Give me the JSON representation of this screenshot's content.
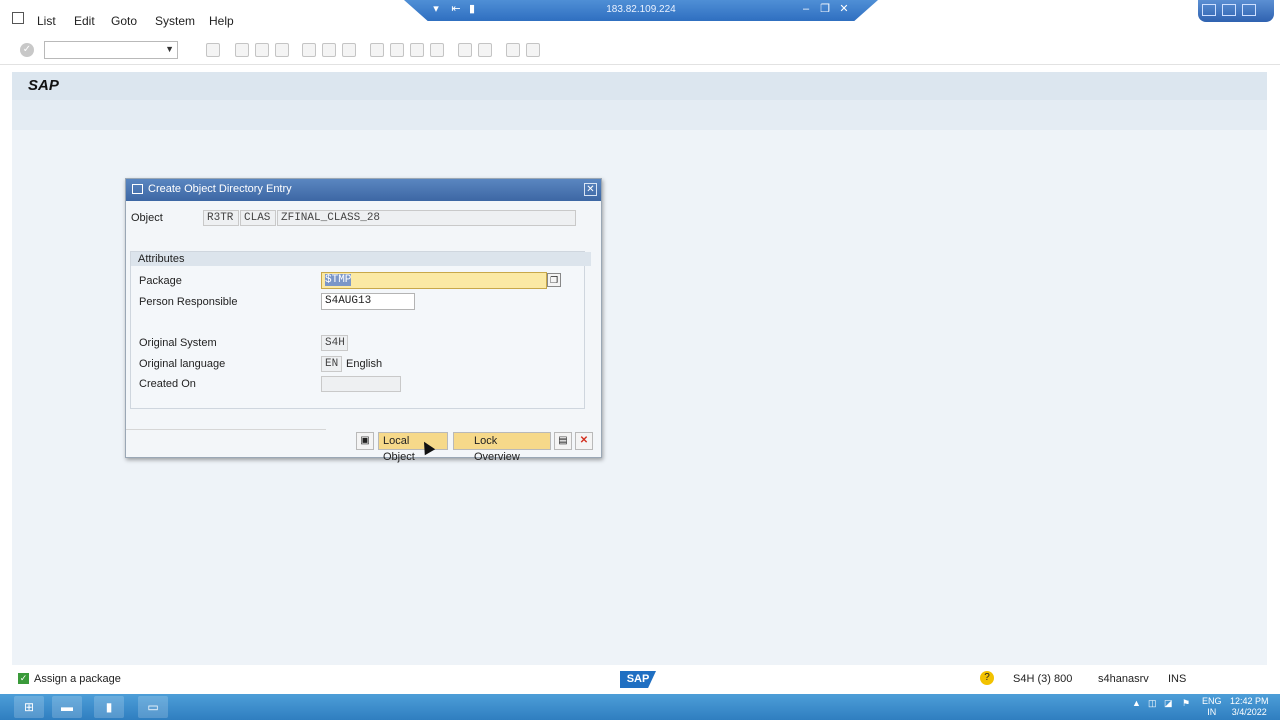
{
  "remote": {
    "ip": "183.82.109.224"
  },
  "menu": {
    "items": [
      "List",
      "Edit",
      "Goto",
      "System",
      "Help"
    ]
  },
  "header": {
    "title": "SAP"
  },
  "dialog": {
    "title": "Create Object Directory Entry",
    "object_label": "Object",
    "object_pgmid": "R3TR",
    "object_type": "CLAS",
    "object_name": "ZFINAL_CLASS_28",
    "attributes_title": "Attributes",
    "package_label": "Package",
    "package_value": "$TMP",
    "person_label": "Person Responsible",
    "person_value": "S4AUG13",
    "orig_system_label": "Original System",
    "orig_system_value": "S4H",
    "orig_lang_label": "Original language",
    "orig_lang_code": "EN",
    "orig_lang_name": "English",
    "created_label": "Created On",
    "created_value": "",
    "local_object_label": "Local Object",
    "lock_overview_label": "Lock Overview"
  },
  "status": {
    "message": "Assign a package",
    "system": "S4H (3) 800",
    "server": "s4hanasrv",
    "mode": "INS",
    "logo": "SAP"
  },
  "taskbar": {
    "lang_top": "ENG",
    "lang_bottom": "IN",
    "time": "12:42 PM",
    "date": "3/4/2022"
  }
}
